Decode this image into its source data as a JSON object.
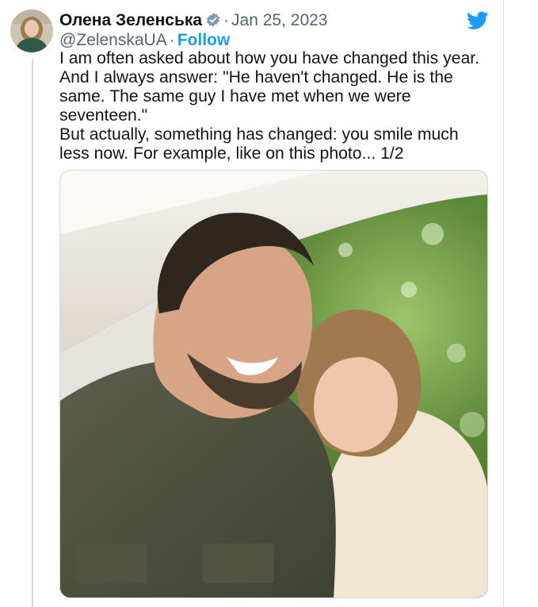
{
  "tweet": {
    "author_name": "Олена Зеленська",
    "handle": "@ZelenskaUA",
    "separator": "·",
    "date": "Jan 25, 2023",
    "follow_label": "Follow",
    "paragraph_1": "I am often asked about how you have changed this year. And I always answer: \"He haven't changed. He is the same. The same guy I have met when we were seventeen.\"",
    "paragraph_2": "But actually, something has changed: you smile much less now. For example, like on this photo... 1/2"
  },
  "icons": {
    "verified": "verified-badge-icon",
    "platform": "twitter-bird-icon"
  },
  "colors": {
    "accent": "#1d9bf0",
    "text": "#0f1419",
    "muted": "#536471",
    "thread_line": "#cfd9de"
  }
}
